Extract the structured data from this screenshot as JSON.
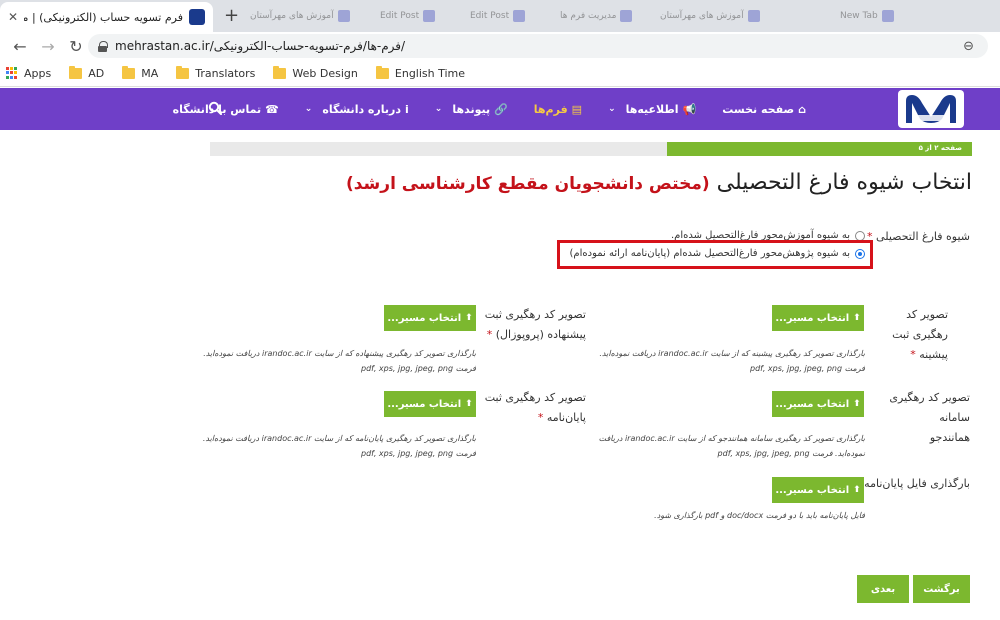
{
  "browser": {
    "active_tab_title": "فرم تسویه حساب (الکترونیکی) | موسسه آمو",
    "background_tabs": [
      "آموزش های مهرآستان",
      "Edit Post",
      "Edit Post",
      "مدیریت فرم ها",
      "آموزش های مهرآستان",
      "New Tab"
    ],
    "url": "mehrastan.ac.ir/فرم-ها/فرم-تسویه-حساب-الکترونیکی/",
    "bookmarks": [
      "Apps",
      "AD",
      "MA",
      "Translators",
      "Web Design",
      "English Time"
    ]
  },
  "nav": {
    "items": [
      {
        "label": "صفحه نخست",
        "icon": "home-icon"
      },
      {
        "label": "اطلاعیه‌ها",
        "icon": "bullhorn-icon"
      },
      {
        "label": "فرم‌ها",
        "icon": "file-icon"
      },
      {
        "label": "پیوندها",
        "icon": "link-icon"
      },
      {
        "label": "درباره دانشگاه",
        "icon": "info-icon"
      },
      {
        "label": "تماس با دانشگاه",
        "icon": "phone-icon"
      }
    ]
  },
  "progress": {
    "label": "صفحه ۲ از ۵",
    "value": 0.4
  },
  "page": {
    "title": "انتخاب شیوه فارغ التحصیلی ",
    "title_accent": "(مختص دانشجویان مقطع کارشناسی ارشد)"
  },
  "graduation": {
    "label": "شیوه فارغ التحصیلی",
    "required_mark": "*",
    "options": [
      {
        "label": "به شیوه آموزش‌محور فارغ‌التحصیل شده‌ام.",
        "checked": false
      },
      {
        "label": "به شیوه پژوهش‌محور فارغ‌التحصیل شده‌ام (پایان‌نامه ارائه نموده‌ام)",
        "checked": true
      }
    ]
  },
  "uploads": {
    "button_label": "انتخاب مسیر...",
    "thesis_reg": {
      "label": "تصویر کد رهگیری ثبت پیشینه",
      "help_line1": "بارگذاری تصویر کد رهگیری پیشینه که از سایت irandoc.ac.ir دریافت نموده‌اید.",
      "help_line2": "فرمت pdf, xps, jpg, jpeg, png"
    },
    "proposal": {
      "label_line1": "تصویر کد رهگیری ثبت",
      "label_line2": "پیشنهاده (پروپوزال)",
      "help_line1": "بارگذاری تصویر کد رهگیری پیشنهاده که از سایت irandoc.ac.ir دریافت نموده‌اید.",
      "help_line2": "فرمت pdf, xps, jpg, jpeg, png"
    },
    "similarity": {
      "label_line1": "تصویر کد رهگیری سامانه",
      "label_line2": "همانندجو",
      "help_line1": "بارگذاری تصویر کد رهگیری سامانه همانندجو که از سایت irandoc.ac.ir دریافت",
      "help_line2": "نموده‌اید. فرمت pdf, xps, jpg, jpeg, png"
    },
    "thesis": {
      "label_line1": "تصویر کد رهگیری ثبت",
      "label_line2": "پایان‌نامه",
      "help_line1": "بارگذاری تصویر کد رهگیری پایان‌نامه که از سایت irandoc.ac.ir دریافت نموده‌اید.",
      "help_line2": "فرمت pdf, xps, jpg, jpeg, png"
    },
    "thesis_file": {
      "label": "بارگذاری فایل پایان‌نامه",
      "help_line1": "فایل پایان‌نامه باید با دو فرمت doc/docx و pdf بارگذاری شود."
    }
  },
  "buttons": {
    "back": "برگشت",
    "next": "بعدی"
  },
  "colors": {
    "nav_bg": "#6f3fc8",
    "accent_green": "#7cb82f",
    "title_accent": "#c4121a",
    "highlight": "#d6121a"
  }
}
